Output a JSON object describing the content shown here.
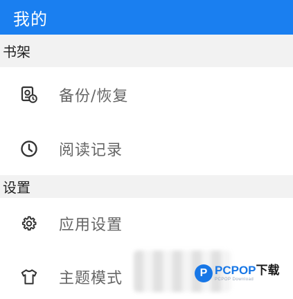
{
  "appbar": {
    "title": "我的"
  },
  "sections": {
    "bookshelf": {
      "header": "书架",
      "items": [
        {
          "label": "备份/恢复",
          "icon": "backup-restore-icon"
        },
        {
          "label": "阅读记录",
          "icon": "clock-icon"
        }
      ]
    },
    "settings": {
      "header": "设置",
      "items": [
        {
          "label": "应用设置",
          "icon": "gear-icon"
        },
        {
          "label": "主题模式",
          "icon": "tshirt-icon"
        }
      ]
    }
  },
  "watermark": {
    "brand_blue": "PCPOP",
    "brand_black": "下载",
    "sub": "PCPOP Download"
  },
  "colors": {
    "accent": "#1a7ff0",
    "section_bg": "#f2f2f2",
    "item_text": "#666666",
    "icon": "#333333"
  }
}
